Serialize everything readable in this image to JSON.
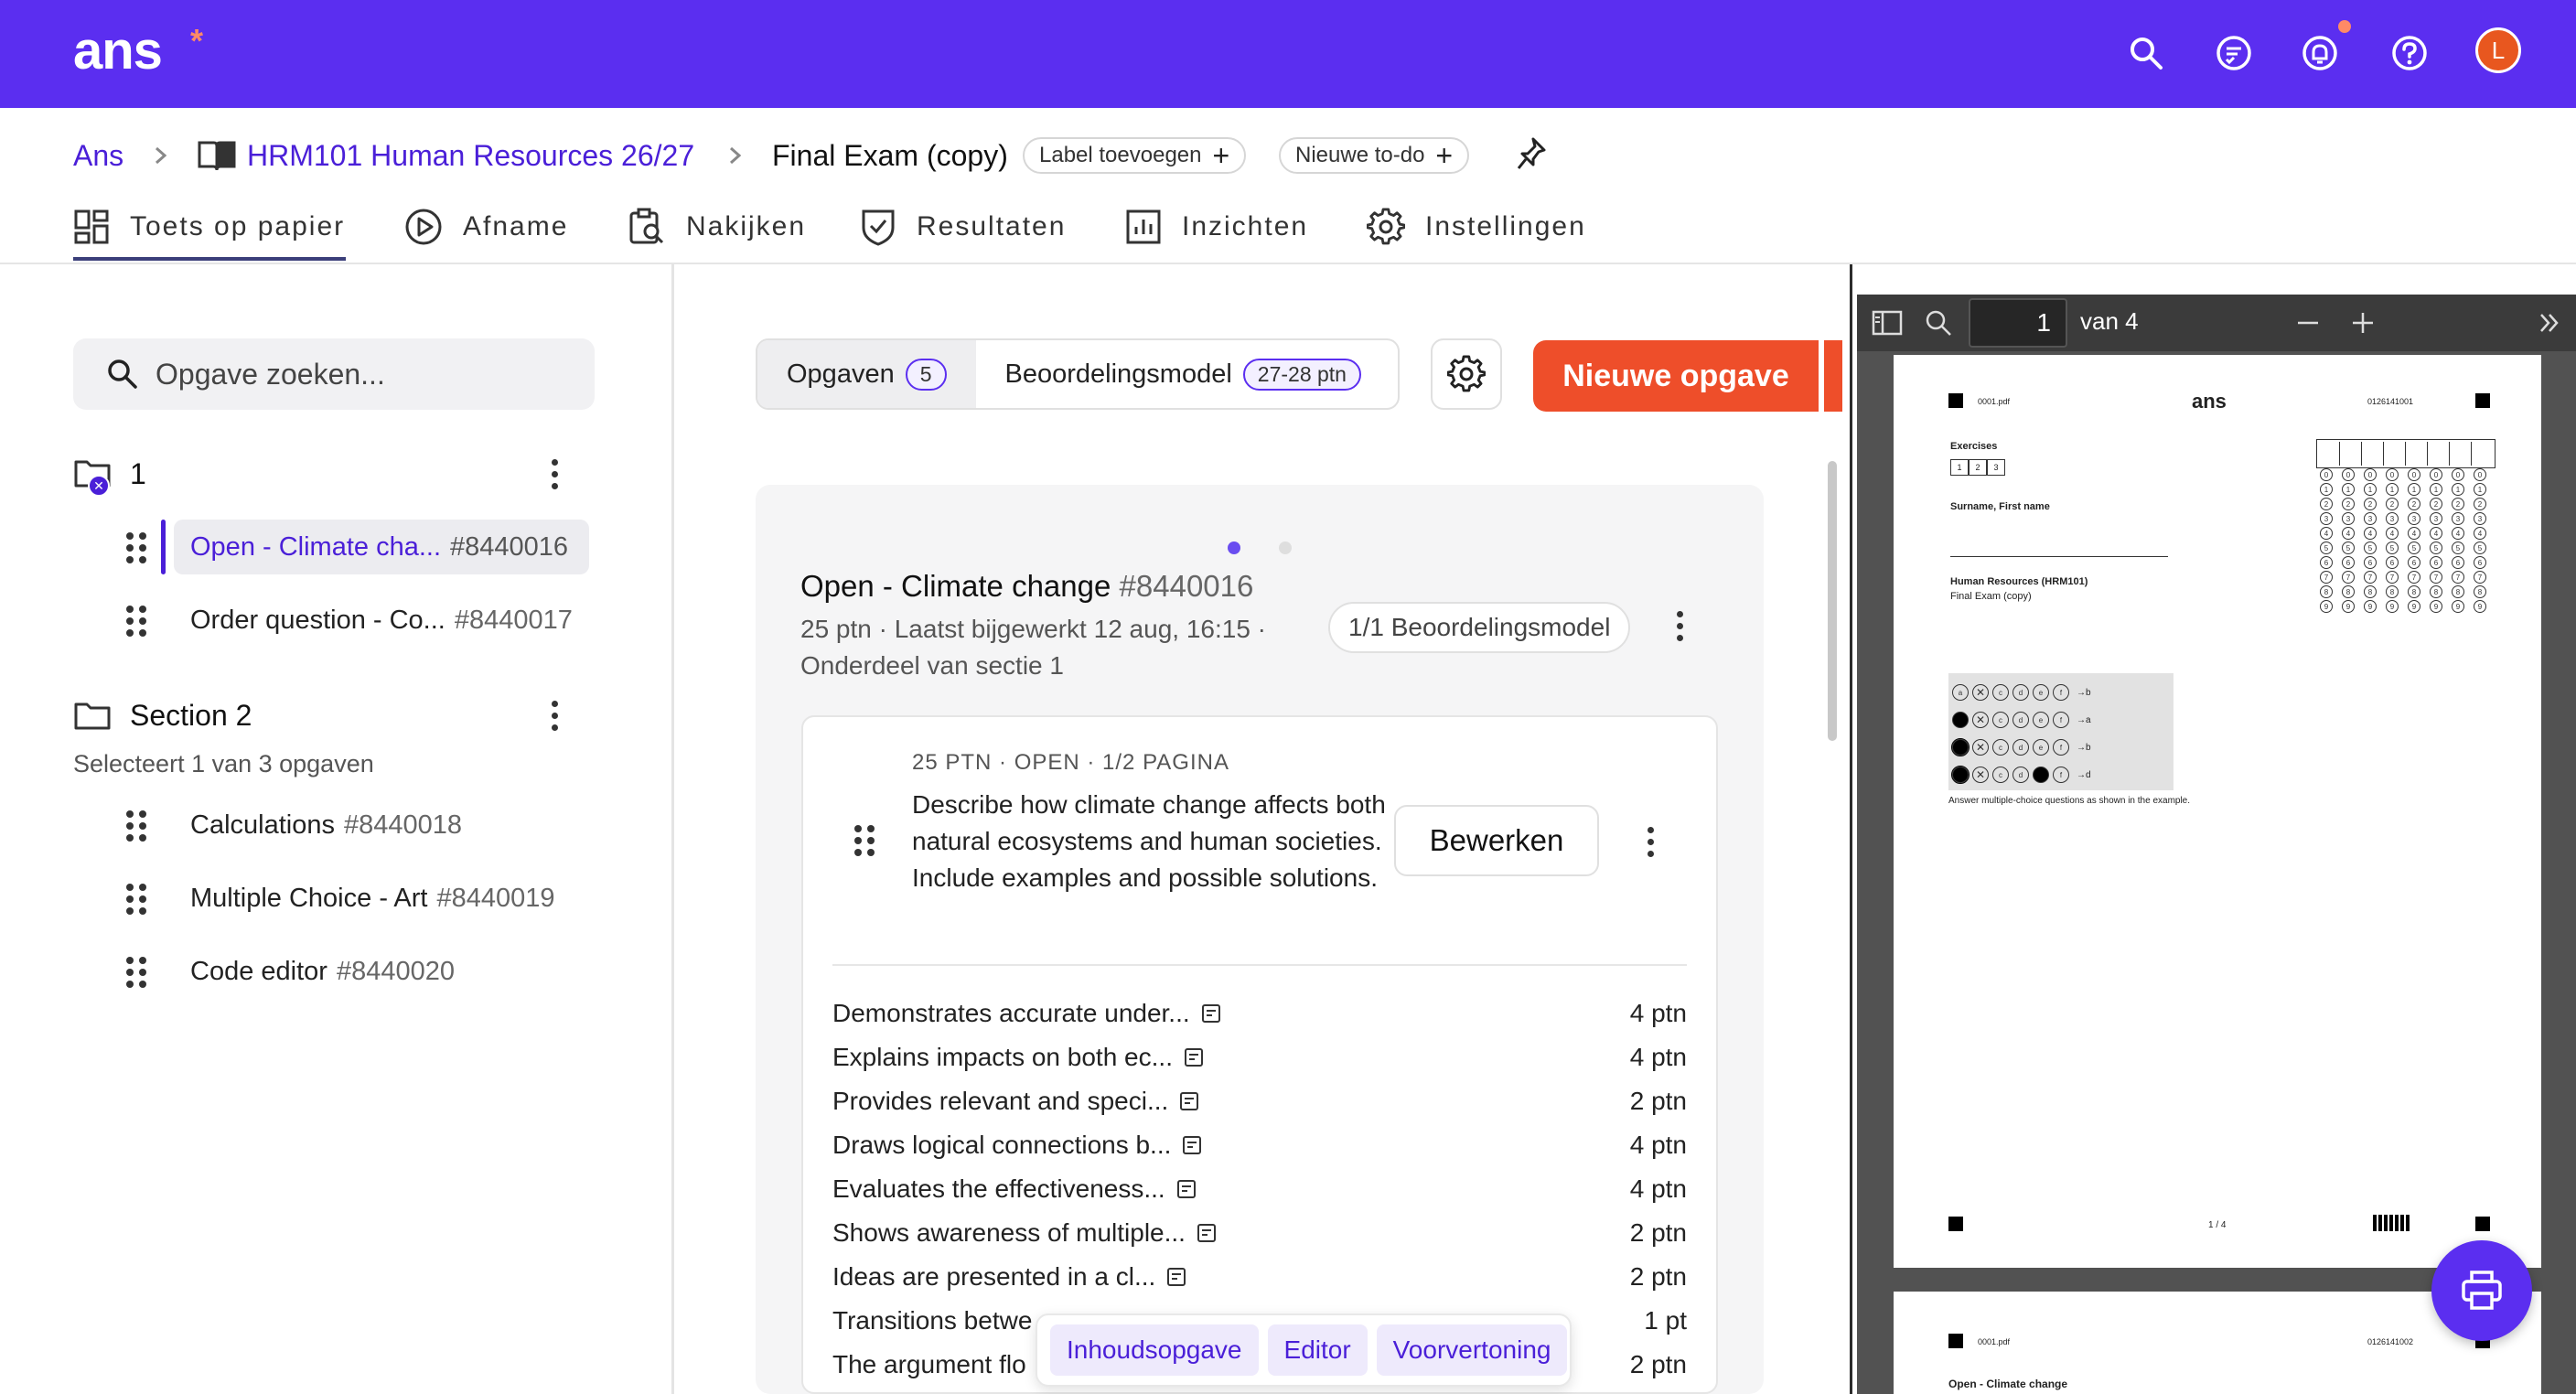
{
  "header": {
    "logo_text": "ans",
    "logo_star": "*",
    "avatar_initial": "L",
    "icons": [
      "search-icon",
      "checklist-icon",
      "bell-icon",
      "help-icon",
      "avatar"
    ]
  },
  "breadcrumb": {
    "root": "Ans",
    "course": "HRM101 Human Resources 26/27",
    "current": "Final Exam (copy)",
    "add_label": "Label toevoegen",
    "new_todo": "Nieuwe to-do"
  },
  "nav": {
    "tabs": [
      {
        "label": "Toets op papier",
        "active": true
      },
      {
        "label": "Afname"
      },
      {
        "label": "Nakijken"
      },
      {
        "label": "Resultaten"
      },
      {
        "label": "Inzichten"
      },
      {
        "label": "Instellingen"
      }
    ]
  },
  "sidebar": {
    "search_placeholder": "Opgave zoeken...",
    "section1": {
      "title": "1",
      "items": [
        {
          "label": "Open - Climate cha...",
          "id": "#8440016",
          "active": true
        },
        {
          "label": "Order question - Co...",
          "id": "#8440017"
        }
      ]
    },
    "section2": {
      "title": "Section 2",
      "hint": "Selecteert 1 van 3 opgaven",
      "items": [
        {
          "label": "Calculations",
          "id": "#8440018"
        },
        {
          "label": "Multiple Choice - Art",
          "id": "#8440019"
        },
        {
          "label": "Code editor",
          "id": "#8440020"
        }
      ]
    }
  },
  "main": {
    "seg_tabs": [
      {
        "label": "Opgaven",
        "badge": "5"
      },
      {
        "label": "Beoordelingsmodel",
        "badge": "27-28 ptn"
      }
    ],
    "new_button": "Nieuwe opgave",
    "question": {
      "title": "Open - Climate change",
      "id": "#8440016",
      "meta_line1": "25 ptn · Laatst bijgewerkt 12 aug, 16:15 ·",
      "meta_line2": "Onderdeel van sectie 1",
      "model_pill": "1/1 Beoordelingsmodel",
      "sub": "25 PTN · OPEN · 1/2 PAGINA",
      "text": "Describe how climate change affects both natural ecosystems and human societies. Include examples and possible solutions.",
      "edit_button": "Bewerken",
      "criteria": [
        {
          "label": "Demonstrates accurate under...",
          "pts": "4 ptn"
        },
        {
          "label": "Explains impacts on both ec...",
          "pts": "4 ptn"
        },
        {
          "label": "Provides relevant and speci...",
          "pts": "2 ptn"
        },
        {
          "label": "Draws logical connections b...",
          "pts": "4 ptn"
        },
        {
          "label": "Evaluates the effectiveness...",
          "pts": "4 ptn"
        },
        {
          "label": "Shows awareness of multiple...",
          "pts": "2 ptn"
        },
        {
          "label": "Ideas are presented in a cl...",
          "pts": "2 ptn"
        },
        {
          "label": "Transitions betwe",
          "pts": "1 pt"
        },
        {
          "label": "The argument flo",
          "pts": "2 ptn"
        }
      ]
    },
    "floating_bar": [
      "Inhoudsopgave",
      "Editor",
      "Voorvertoning"
    ]
  },
  "pdf": {
    "page_value": "1",
    "page_of": "van 4",
    "page1": {
      "file": "0001.pdf",
      "logo": "ans",
      "code": "0126141001",
      "exercises_label": "Exercises",
      "exercise_boxes": [
        "1",
        "2",
        "3"
      ],
      "name_label": "Surname, First name",
      "course": "Human Resources (HRM101)",
      "exam": "Final Exam (copy)",
      "mc_instruction": "Answer multiple-choice questions as shown in the example.",
      "mc_rows": [
        "→b",
        "→a",
        "→b",
        "→d"
      ],
      "page_num": "1 / 4"
    },
    "page2": {
      "file": "0001.pdf",
      "code": "0126141002",
      "title": "Open - Climate change"
    }
  }
}
